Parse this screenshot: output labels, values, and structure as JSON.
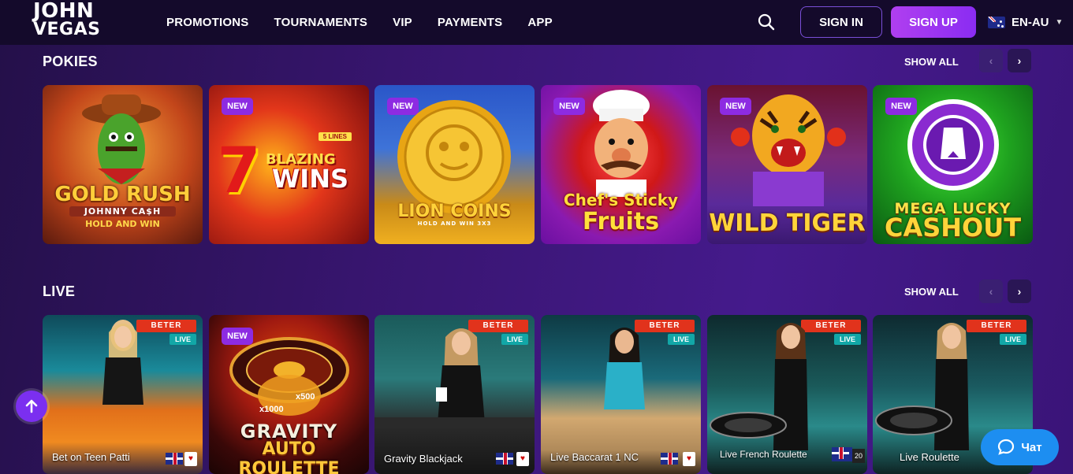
{
  "header": {
    "logo": {
      "line1": "JOHN",
      "line2": "VEGAS"
    },
    "nav": [
      "PROMOTIONS",
      "TOURNAMENTS",
      "VIP",
      "PAYMENTS",
      "APP"
    ],
    "sign_in": "SIGN IN",
    "sign_up": "SIGN UP",
    "language": "EN-AU",
    "search_icon": "search-icon"
  },
  "sections": [
    {
      "title": "POKIES",
      "show_all": "SHOW ALL",
      "games": [
        {
          "title_line1": "GOLD RUSH",
          "title_line2": "JOHNNY CA$H",
          "title_line3": "HOLD AND WIN",
          "new": false
        },
        {
          "title_line1": "7",
          "title_line2": "BLAZING",
          "title_line3": "WINS",
          "extra": "5 LINES",
          "badge": "NEW"
        },
        {
          "title_line1": "LION COINS",
          "title_line2": "HOLD AND WIN 3X3",
          "badge": "NEW"
        },
        {
          "title_line1": "Chef's Sticky",
          "title_line2": "Fruits",
          "badge": "NEW"
        },
        {
          "title_line1": "WILD TIGER",
          "badge": "NEW"
        },
        {
          "title_line1": "MEGA LUCKY",
          "title_line2": "CASHOUT",
          "badge": "NEW"
        }
      ]
    },
    {
      "title": "LIVE",
      "show_all": "SHOW ALL",
      "games": [
        {
          "label": "Bet on Teen Patti",
          "provider": "BETER",
          "tag": "LIVE"
        },
        {
          "title_line1": "GRAVITY",
          "title_line2": "AUTO ROULETTE",
          "mult1": "x1000",
          "mult2": "x500",
          "badge": "NEW"
        },
        {
          "label": "Gravity Blackjack",
          "provider": "BETER",
          "tag": "LIVE"
        },
        {
          "label": "Live Baccarat 1 NC",
          "provider": "BETER",
          "tag": "LIVE"
        },
        {
          "label": "Live French Roulette",
          "provider": "BETER",
          "tag": "LIVE",
          "limit": "20"
        },
        {
          "label": "Live Roulette",
          "provider": "BETER",
          "tag": "LIVE"
        }
      ]
    }
  ],
  "chat": {
    "label": "Чат"
  },
  "scroll_up_icon": "arrow-up-icon"
}
